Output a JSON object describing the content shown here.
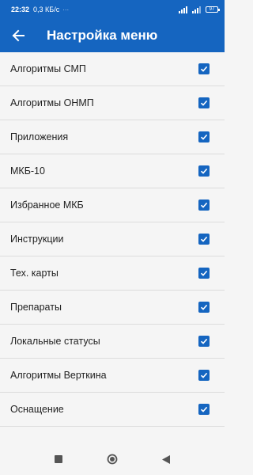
{
  "status_bar": {
    "time": "22:32",
    "net_speed": "0,3 КБ/с",
    "dots": "···",
    "battery": "97"
  },
  "app_bar": {
    "title": "Настройка меню",
    "back_icon": "arrow-back-icon"
  },
  "colors": {
    "primary": "#1565c0",
    "background": "#f5f5f5",
    "divider": "#dcdcdc"
  },
  "menu_items": [
    {
      "label": "Алгоритмы СМП",
      "checked": true
    },
    {
      "label": "Алгоритмы ОНМП",
      "checked": true
    },
    {
      "label": "Приложения",
      "checked": true
    },
    {
      "label": "МКБ-10",
      "checked": true
    },
    {
      "label": "Избранное МКБ",
      "checked": true
    },
    {
      "label": "Инструкции",
      "checked": true
    },
    {
      "label": "Тех. карты",
      "checked": true
    },
    {
      "label": "Препараты",
      "checked": true
    },
    {
      "label": "Локальные статусы",
      "checked": true
    },
    {
      "label": "Алгоритмы Верткина",
      "checked": true
    },
    {
      "label": "Оснащение",
      "checked": true
    }
  ],
  "nav_bar": {
    "recents_icon": "square-icon",
    "home_icon": "circle-icon",
    "back_icon": "triangle-back-icon"
  }
}
